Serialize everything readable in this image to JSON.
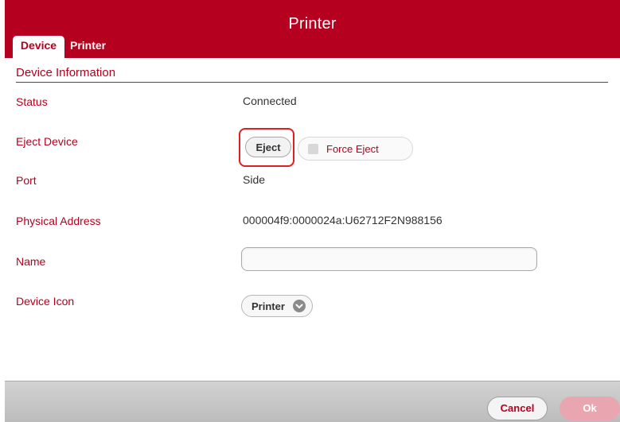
{
  "window": {
    "title": "Printer"
  },
  "tabs": [
    {
      "label": "Device",
      "active": true
    },
    {
      "label": "Printer",
      "active": false
    }
  ],
  "section": {
    "title": "Device Information"
  },
  "fields": {
    "status": {
      "label": "Status",
      "value": "Connected"
    },
    "eject": {
      "label": "Eject Device",
      "button": "Eject",
      "force_eject_label": "Force Eject",
      "force_eject_checked": false
    },
    "port": {
      "label": "Port",
      "value": "Side"
    },
    "physical_address": {
      "label": "Physical Address",
      "value": "000004f9:0000024a:U62712F2N988156"
    },
    "name": {
      "label": "Name",
      "value": "",
      "placeholder": ""
    },
    "device_icon": {
      "label": "Device Icon",
      "selected": "Printer"
    }
  },
  "footer": {
    "cancel": "Cancel",
    "ok": "Ok"
  },
  "colors": {
    "accent": "#b5001f",
    "ok_disabled": "#e9a6b1",
    "highlight": "#e02020"
  }
}
